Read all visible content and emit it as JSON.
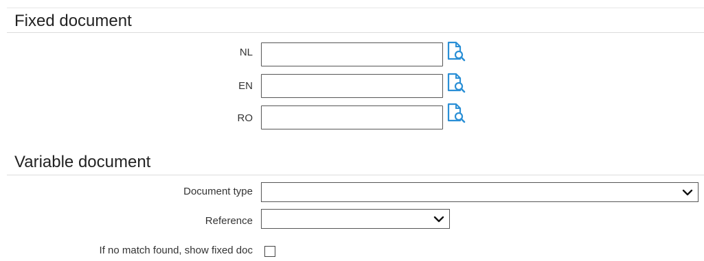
{
  "fixed_document": {
    "title": "Fixed document",
    "fields": [
      {
        "label": "NL",
        "value": "",
        "lookup_icon": "document-search-icon"
      },
      {
        "label": "EN",
        "value": "",
        "lookup_icon": "document-search-icon"
      },
      {
        "label": "RO",
        "value": "",
        "lookup_icon": "document-search-icon"
      }
    ]
  },
  "variable_document": {
    "title": "Variable document",
    "document_type": {
      "label": "Document type",
      "selected": ""
    },
    "reference": {
      "label": "Reference",
      "selected": ""
    },
    "fallback": {
      "label": "If no match found, show fixed doc",
      "checked": false
    }
  },
  "colors": {
    "icon_accent": "#2a8fd6",
    "border": "#555555"
  }
}
